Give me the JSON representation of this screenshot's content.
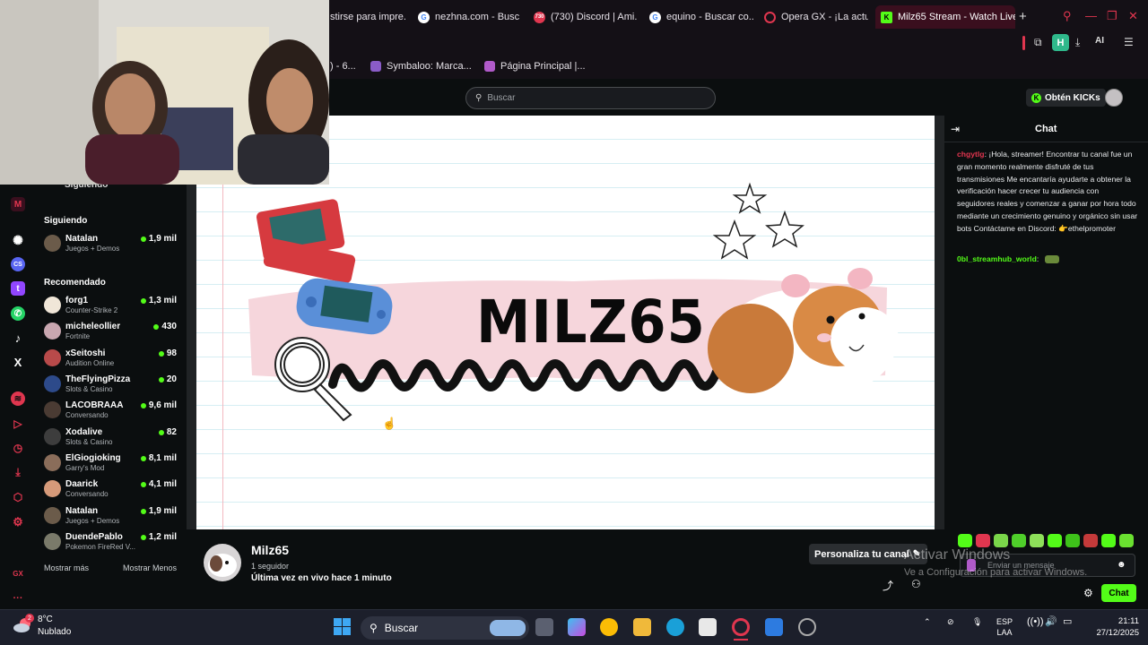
{
  "browser": {
    "tabs": [
      {
        "label": "stirse para impre..."
      },
      {
        "label": "nezhna.com - Busc..."
      },
      {
        "label": "(730) Discord | Ami..."
      },
      {
        "label": "equino - Buscar co..."
      },
      {
        "label": "Opera GX - ¡La actu..."
      },
      {
        "label": "Milz65 Stream - Watch Live..."
      }
    ],
    "bookmarks": [
      {
        "label": ") - 6..."
      },
      {
        "label": "Symbaloo: Marca..."
      },
      {
        "label": "Página Principal |..."
      }
    ],
    "toolbar_ai": "AI",
    "profile_letter": "H",
    "discord_badge": "730"
  },
  "header": {
    "search_placeholder": "Buscar",
    "get_kicks_label": "Obtén KICKs"
  },
  "sidebar": {
    "partial_title": "Siguiendo",
    "following_title": "Siguiendo",
    "following": [
      {
        "name": "Natalan",
        "category": "Juegos + Demos",
        "viewers": "1,9 mil"
      }
    ],
    "recommended_title": "Recomendado",
    "recommended": [
      {
        "name": "forg1",
        "category": "Counter-Strike 2",
        "viewers": "1,3 mil"
      },
      {
        "name": "micheleollier",
        "category": "Fortnite",
        "viewers": "430"
      },
      {
        "name": "xSeitoshi",
        "category": "Audition Online",
        "viewers": "98"
      },
      {
        "name": "TheFlyingPizza",
        "category": "Slots & Casino",
        "viewers": "20"
      },
      {
        "name": "LACOBRAAA",
        "category": "Conversando",
        "viewers": "9,6 mil"
      },
      {
        "name": "Xodalive",
        "category": "Slots & Casino",
        "viewers": "82"
      },
      {
        "name": "ElGiogioking",
        "category": "Garry's Mod",
        "viewers": "8,1 mil"
      },
      {
        "name": "Daarick",
        "category": "Conversando",
        "viewers": "4,1 mil"
      },
      {
        "name": "Natalan",
        "category": "Juegos + Demos",
        "viewers": "1,9 mil"
      },
      {
        "name": "DuendePablo",
        "category": "Pokemon FireRed V...",
        "viewers": "1,2 mil"
      }
    ],
    "show_more": "Mostrar más",
    "show_less": "Mostrar Menos"
  },
  "player": {
    "banner_text": "MILZ65"
  },
  "channel": {
    "name": "Milz65",
    "followers": "1 seguidor",
    "last_live": "Última vez en vivo hace 1 minuto",
    "customize_label": "Personaliza tu canal"
  },
  "chat": {
    "title": "Chat",
    "messages": [
      {
        "user": "chgytlg",
        "text": ": ¡Hola, streamer! Encontrar tu canal fue un gran momento realmente disfruté de tus transmisiones Me encantaría ayudarte a obtener la verificación hacer crecer tu audiencia con seguidores reales y comenzar a ganar por hora todo mediante un crecimiento genuino y orgánico sin usar bots Contáctame en Discord: 👉ethelpromoter"
      },
      {
        "user": "0bl_streamhub_world",
        "text": ":"
      }
    ],
    "input_placeholder": "Enviar un mensaje",
    "send_label": "Chat"
  },
  "watermark": {
    "line1": "Activar Windows",
    "line2": "Ve a Configuración para activar Windows."
  },
  "taskbar": {
    "weather_temp": "8°C",
    "weather_desc": "Nublado",
    "weather_badge": "2",
    "search_label": "Buscar",
    "lang_top": "ESP",
    "lang_bottom": "LAA",
    "time": "21:11",
    "date": "27/12/2025"
  },
  "colors": {
    "kick_green": "#53fc18",
    "opera_red": "#e0364f",
    "page_bg": "#0b0e0f"
  }
}
